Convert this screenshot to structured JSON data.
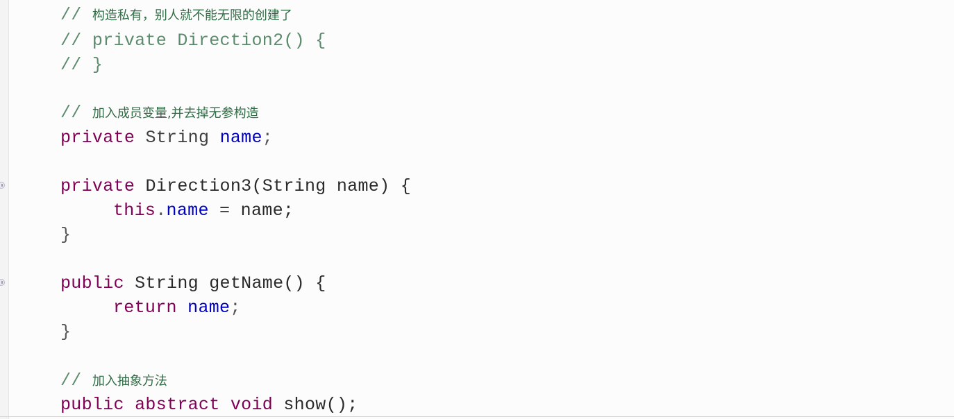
{
  "editor": {
    "lines": [
      {
        "comment_prefix": "// ",
        "comment_text": "构造私有，别人就不能无限的创建了"
      },
      {
        "comment_prefix": "// ",
        "comment_code": "private Direction2() {"
      },
      {
        "comment_prefix": "// ",
        "comment_code": "}"
      },
      {
        "comment_prefix": "// ",
        "comment_text": "加入成员变量,并去掉无参构造"
      },
      {
        "kw": "private",
        "type": "String",
        "field": "name",
        "end": ";"
      },
      {
        "kw": "private",
        "rest": "Direction3(String name) {"
      },
      {
        "kw": "this",
        "dot": ".",
        "field": "name",
        "rest": " = name;"
      },
      {
        "brace": "}"
      },
      {
        "kw": "public",
        "rest": "String getName() {"
      },
      {
        "kw": "return",
        "field": "name",
        "end": ";"
      },
      {
        "brace": "}"
      },
      {
        "comment_prefix": "// ",
        "comment_text": "加入抽象方法"
      },
      {
        "kw": "public abstract void",
        "rest": "show();"
      }
    ]
  },
  "colors": {
    "keyword": "#7f0055",
    "field": "#0000c0",
    "comment": "#5b8a6c",
    "background": "#fcfcfc"
  },
  "icons": {
    "fold_markers": [
      "fold-collapse-icon",
      "fold-collapse-icon"
    ]
  }
}
